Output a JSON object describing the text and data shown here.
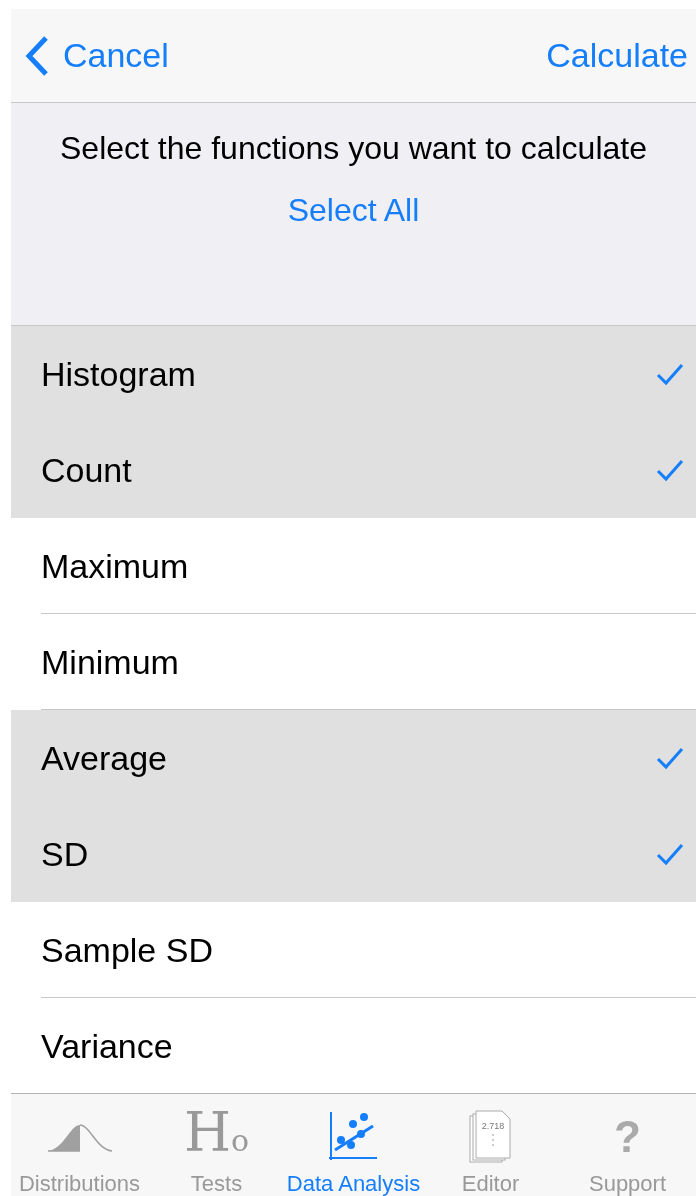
{
  "nav": {
    "back": "Cancel",
    "action": "Calculate"
  },
  "header": {
    "prompt": "Select the functions you want to calculate",
    "select_all": "Select All"
  },
  "functions": [
    {
      "label": "Histogram",
      "selected": true
    },
    {
      "label": "Count",
      "selected": true
    },
    {
      "label": "Maximum",
      "selected": false
    },
    {
      "label": "Minimum",
      "selected": false
    },
    {
      "label": "Average",
      "selected": true
    },
    {
      "label": "SD",
      "selected": true
    },
    {
      "label": "Sample SD",
      "selected": false
    },
    {
      "label": "Variance",
      "selected": false
    }
  ],
  "tabs": [
    {
      "label": "Distributions",
      "kind": "bell",
      "selected": false
    },
    {
      "label": "Tests",
      "kind": "glyph",
      "icon_text": "H$_{o}$",
      "selected": false
    },
    {
      "label": "Data Analysis",
      "kind": "scatter",
      "selected": true
    },
    {
      "label": "Editor",
      "kind": "pages",
      "icon_text": "2.718",
      "selected": false
    },
    {
      "label": "Support",
      "kind": "glyph",
      "icon_text": "?",
      "selected": false
    }
  ]
}
